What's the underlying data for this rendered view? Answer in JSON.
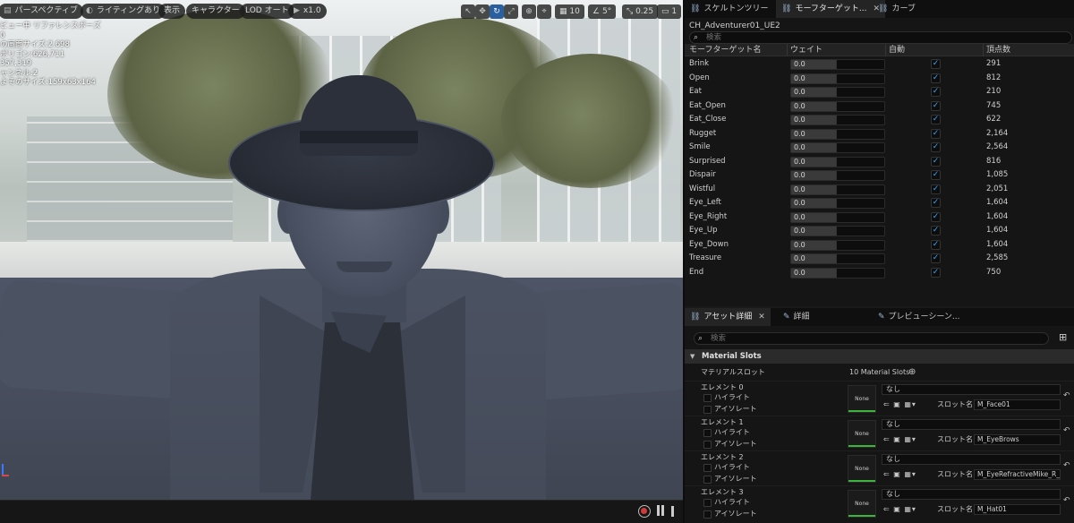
{
  "viewport": {
    "toolbar": {
      "perspective": "パースペクティブ",
      "lighting": "ライティングあり",
      "show": "表示",
      "character": "キャラクター",
      "lod": "LOD オート",
      "play_speed": "x1.0",
      "grid_value": "10",
      "angle_value": "5°",
      "scale_value": "0.25",
      "camera_value": "1"
    },
    "stats": [
      "ビュー中 リファレンスポーズ",
      "0",
      "の画面サイズ:2.698",
      "ポリゴン:626,711",
      "357,319",
      "ャンネル:2",
      "よそのサイズ:159x63x164"
    ]
  },
  "tabs": {
    "skeleton_tree": "スケルトンツリー",
    "morph_target": "モーフターゲット...",
    "curve": "カーブ"
  },
  "morph": {
    "asset_name": "CH_Adventurer01_UE2",
    "search_placeholder": "検索",
    "columns": {
      "name": "モーフターゲット名",
      "weight": "ウェイト",
      "auto": "自動",
      "vertices": "頂点数"
    },
    "rows": [
      {
        "name": "Brink",
        "weight": "0.0",
        "auto": true,
        "vertices": "291"
      },
      {
        "name": "Open",
        "weight": "0.0",
        "auto": true,
        "vertices": "812"
      },
      {
        "name": "Eat",
        "weight": "0.0",
        "auto": true,
        "vertices": "210"
      },
      {
        "name": "Eat_Open",
        "weight": "0.0",
        "auto": true,
        "vertices": "745"
      },
      {
        "name": "Eat_Close",
        "weight": "0.0",
        "auto": true,
        "vertices": "622"
      },
      {
        "name": "Rugget",
        "weight": "0.0",
        "auto": true,
        "vertices": "2,164"
      },
      {
        "name": "Smile",
        "weight": "0.0",
        "auto": true,
        "vertices": "2,564"
      },
      {
        "name": "Surprised",
        "weight": "0.0",
        "auto": true,
        "vertices": "816"
      },
      {
        "name": "Dispair",
        "weight": "0.0",
        "auto": true,
        "vertices": "1,085"
      },
      {
        "name": "Wistful",
        "weight": "0.0",
        "auto": true,
        "vertices": "2,051"
      },
      {
        "name": "Eye_Left",
        "weight": "0.0",
        "auto": true,
        "vertices": "1,604"
      },
      {
        "name": "Eye_Right",
        "weight": "0.0",
        "auto": true,
        "vertices": "1,604"
      },
      {
        "name": "Eye_Up",
        "weight": "0.0",
        "auto": true,
        "vertices": "1,604"
      },
      {
        "name": "Eye_Down",
        "weight": "0.0",
        "auto": true,
        "vertices": "1,604"
      },
      {
        "name": "Treasure",
        "weight": "0.0",
        "auto": true,
        "vertices": "2,585"
      },
      {
        "name": "End",
        "weight": "0.0",
        "auto": true,
        "vertices": "750"
      }
    ]
  },
  "lower_tabs": {
    "asset_details": "アセット詳細",
    "details": "詳細",
    "preview_scene": "プレビューシーン..."
  },
  "details": {
    "search_placeholder": "検索",
    "section_title": "Material Slots",
    "material_slots_label": "マテリアルスロット",
    "material_slots_count": "10 Material Slots",
    "highlight_label": "ハイライト",
    "isolate_label": "アイソレート",
    "thumbnail_label": "None",
    "none_value": "なし",
    "slot_name_label": "スロット名",
    "elements": [
      {
        "title": "エレメント 0",
        "slot_name": "M_Face01"
      },
      {
        "title": "エレメント 1",
        "slot_name": "M_EyeBrows"
      },
      {
        "title": "エレメント 2",
        "slot_name": "M_EyeRefractiveMike_R_Inst"
      },
      {
        "title": "エレメント 3",
        "slot_name": "M_Hat01"
      }
    ]
  }
}
